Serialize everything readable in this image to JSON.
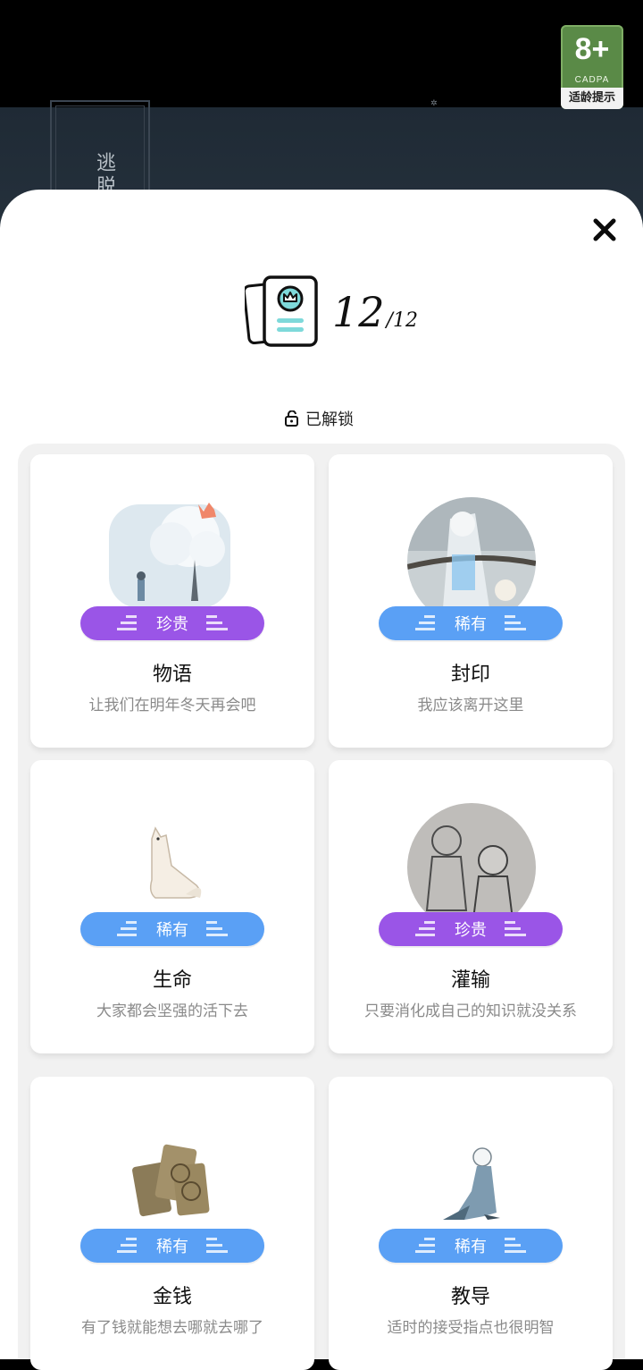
{
  "background": {
    "book_title": "逃脱",
    "age_rating": {
      "number": "8+",
      "org": "CADPA",
      "footer": "适龄提示"
    }
  },
  "collection": {
    "count": "12",
    "total": "/12",
    "unlocked_label": "已解锁"
  },
  "items": [
    {
      "name": "物语",
      "desc": "让我们在明年冬天再会吧",
      "rarity": "珍贵",
      "icon": "snow-tree-image"
    },
    {
      "name": "封印",
      "desc": "我应该离开这里",
      "rarity": "稀有",
      "icon": "seal-image"
    },
    {
      "name": "生命",
      "desc": "大家都会坚强的活下去",
      "rarity": "稀有",
      "icon": "fox-image"
    },
    {
      "name": "灌输",
      "desc": "只要消化成自己的知识就没关系",
      "rarity": "珍贵",
      "icon": "children-sketch-image"
    },
    {
      "name": "金钱",
      "desc": "有了钱就能想去哪就去哪了",
      "rarity": "稀有",
      "icon": "coins-image"
    },
    {
      "name": "教导",
      "desc": "适时的接受指点也很明智",
      "rarity": "稀有",
      "icon": "kneeling-figure-image"
    }
  ],
  "colors": {
    "rare": "#5aa0f5",
    "precious": "#9a55e7",
    "sheet": "#ffffff",
    "panel": "#f1f1f1"
  }
}
